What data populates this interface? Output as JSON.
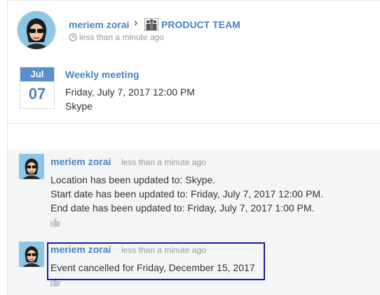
{
  "post": {
    "author": "meriem zorai",
    "breadcrumb_separator": "›",
    "team": "PRODUCT TEAM",
    "time": "less than a minute ago"
  },
  "event": {
    "month": "Jul",
    "day": "07",
    "title": "Weekly meeting",
    "datetime": "Friday, July 7, 2017 12:00 PM",
    "location": "Skype"
  },
  "comments": [
    {
      "author": "meriem zorai",
      "time": "less than a minute ago",
      "lines": [
        "Location has been updated to: Skype.",
        "Start date has been updated to: Friday, July 7, 2017 12:00 PM.",
        "End date has been updated to: Friday, July 7, 2017 1:00 PM."
      ]
    },
    {
      "author": "meriem zorai",
      "time": "less than a minute ago",
      "lines": [
        "Event cancelled for Friday, December 15, 2017"
      ]
    }
  ],
  "colors": {
    "link": "#4a82c4",
    "badge_month_bg": "#5b8ecb",
    "comments_bg": "#f4f5f7",
    "highlight_border": "#1a1aaa"
  },
  "icons": [
    "clock-icon",
    "team-icon",
    "thumbs-up-icon"
  ]
}
